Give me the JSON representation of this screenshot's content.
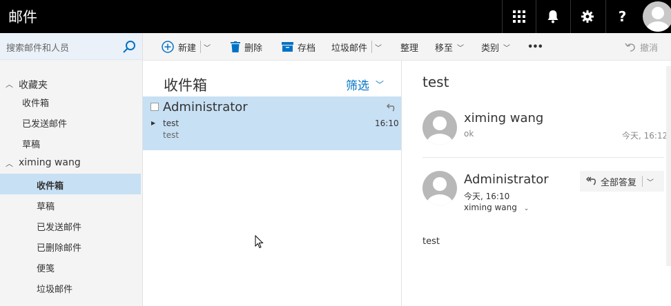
{
  "app": {
    "title": "邮件"
  },
  "topbar": {
    "icons": [
      "app-launcher-icon",
      "bell-icon",
      "gear-icon",
      "help-icon",
      "user-avatar-icon"
    ],
    "help_glyph": "?"
  },
  "search": {
    "placeholder": "搜索邮件和人员"
  },
  "nav": {
    "favorites": {
      "label": "收藏夹",
      "items": [
        "收件箱",
        "已发送邮件",
        "草稿"
      ]
    },
    "account": {
      "label": "ximing wang",
      "items": [
        "收件箱",
        "草稿",
        "已发送邮件",
        "已删除邮件",
        "便笺",
        "垃圾邮件"
      ],
      "selected": "收件箱"
    }
  },
  "toolbar": {
    "new": "新建",
    "delete": "删除",
    "archive": "存档",
    "junk": "垃圾邮件",
    "sweep": "整理",
    "move_to": "移至",
    "categories": "类别",
    "more": "•••",
    "undo": "撤消"
  },
  "list": {
    "title": "收件箱",
    "filter": "筛选",
    "messages": [
      {
        "sender": "Administrator",
        "subject": "test",
        "time": "16:10",
        "preview": "test"
      }
    ]
  },
  "reading": {
    "subject": "test",
    "messages": [
      {
        "sender": "ximing wang",
        "snippet": "ok",
        "time": "今天, 16:12"
      },
      {
        "sender": "Administrator",
        "time": "今天, 16:10",
        "to": "ximing wang"
      }
    ],
    "reply_all": "全部答复",
    "body": "test"
  },
  "colors": {
    "accent": "#0072c6",
    "selected": "#c7e0f4",
    "topbar": "#000000"
  }
}
